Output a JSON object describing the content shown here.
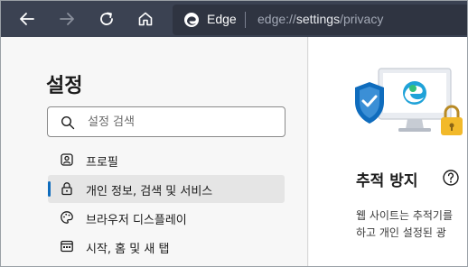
{
  "browser": {
    "app_name": "Edge",
    "url_scheme": "edge://",
    "url_host": "settings",
    "url_path": "/privacy"
  },
  "sidebar": {
    "title": "설정",
    "search_placeholder": "설정 검색",
    "items": [
      {
        "label": "프로필",
        "icon": "profile-icon"
      },
      {
        "label": "개인 정보, 검색 및 서비스",
        "icon": "lock-icon",
        "active": true
      },
      {
        "label": "브라우저 디스플레이",
        "icon": "palette-icon"
      },
      {
        "label": "시작, 홈 및 새 탭",
        "icon": "start-page-icon"
      }
    ]
  },
  "main": {
    "section_title": "추적 방지",
    "desc_line1": "웹 사이트는 추적기를",
    "desc_line2": "하고 개인 설정된 광"
  },
  "colors": {
    "topbar": "#3b4252",
    "accent": "#0f6cbd",
    "active_item_bg": "#e5e5e5"
  }
}
